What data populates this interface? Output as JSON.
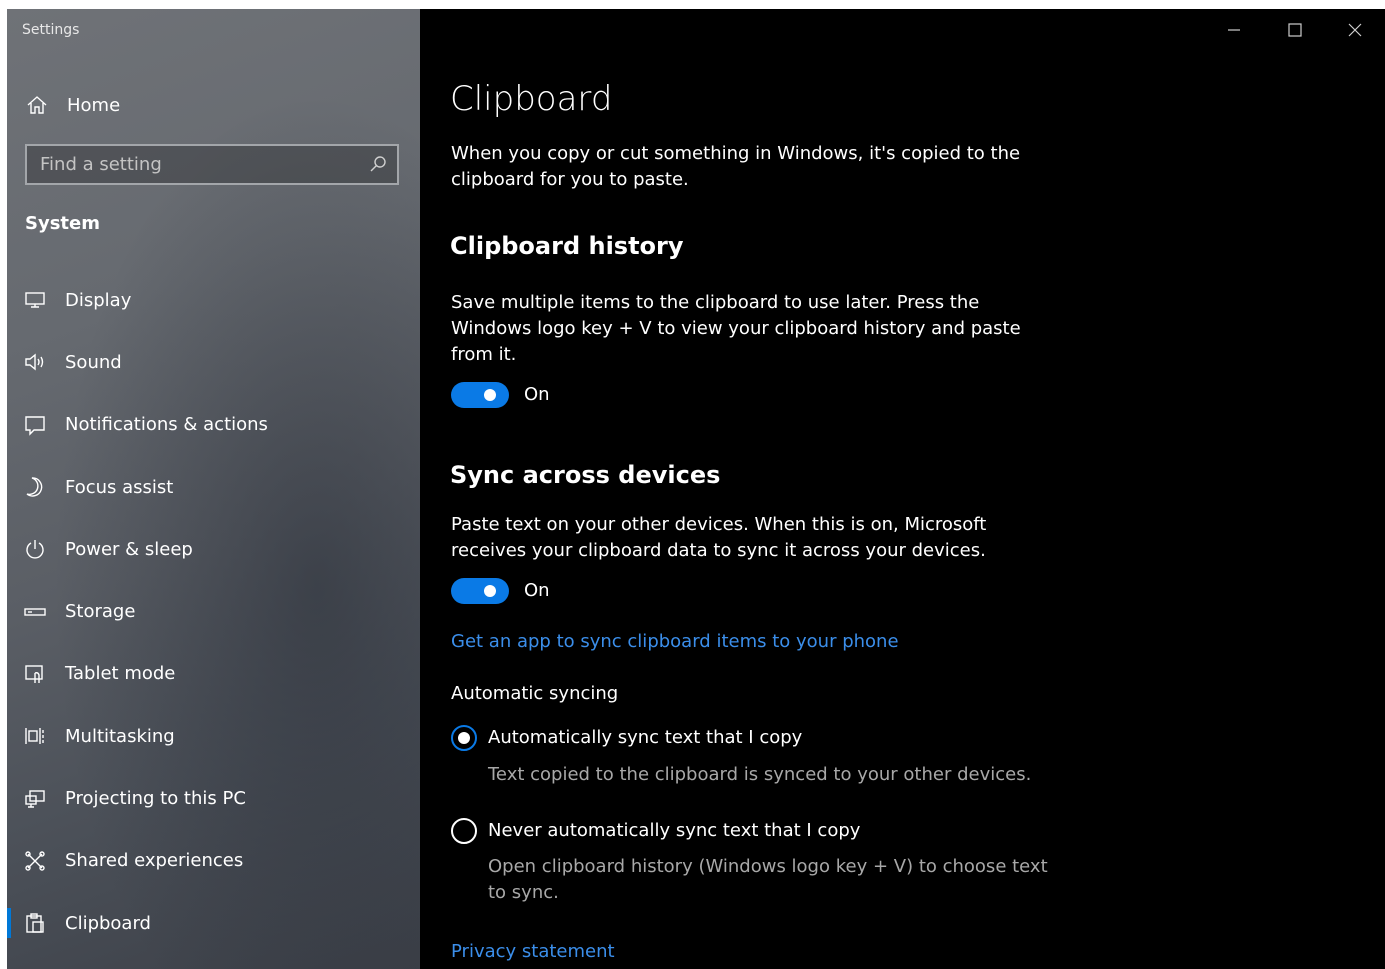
{
  "window": {
    "title": "Settings"
  },
  "sidebar": {
    "home_label": "Home",
    "search": {
      "placeholder": "Find a setting"
    },
    "section_title": "System",
    "items": [
      {
        "label": "Display",
        "icon": "monitor-icon"
      },
      {
        "label": "Sound",
        "icon": "speaker-icon"
      },
      {
        "label": "Notifications & actions",
        "icon": "notification-icon"
      },
      {
        "label": "Focus assist",
        "icon": "moon-icon"
      },
      {
        "label": "Power & sleep",
        "icon": "power-icon"
      },
      {
        "label": "Storage",
        "icon": "storage-icon"
      },
      {
        "label": "Tablet mode",
        "icon": "tablet-icon"
      },
      {
        "label": "Multitasking",
        "icon": "multitasking-icon"
      },
      {
        "label": "Projecting to this PC",
        "icon": "projecting-icon"
      },
      {
        "label": "Shared experiences",
        "icon": "shared-icon"
      },
      {
        "label": "Clipboard",
        "icon": "clipboard-icon",
        "active": true
      }
    ]
  },
  "content": {
    "title": "Clipboard",
    "intro": "When you copy or cut something in Windows, it's copied to the clipboard for you to paste.",
    "history": {
      "heading": "Clipboard history",
      "description": "Save multiple items to the clipboard to use later. Press the Windows logo key + V to view your clipboard history and paste from it.",
      "toggle_state": "On"
    },
    "sync": {
      "heading": "Sync across devices",
      "description": "Paste text on your other devices. When this is on, Microsoft receives your clipboard data to sync it across your devices.",
      "toggle_state": "On",
      "app_link": "Get an app to sync clipboard items to your phone",
      "auto_title": "Automatic syncing",
      "options": [
        {
          "label": "Automatically sync text that I copy",
          "description": "Text copied to the clipboard is synced to your other devices.",
          "selected": true
        },
        {
          "label": "Never automatically sync text that I copy",
          "description": "Open clipboard history (Windows logo key + V) to choose text to sync.",
          "selected": false
        }
      ]
    },
    "privacy_link": "Privacy statement"
  },
  "colors": {
    "accent": "#0a7ae6",
    "link": "#3b8eea",
    "content_bg": "#000000",
    "muted_text": "#a8a8a8"
  }
}
